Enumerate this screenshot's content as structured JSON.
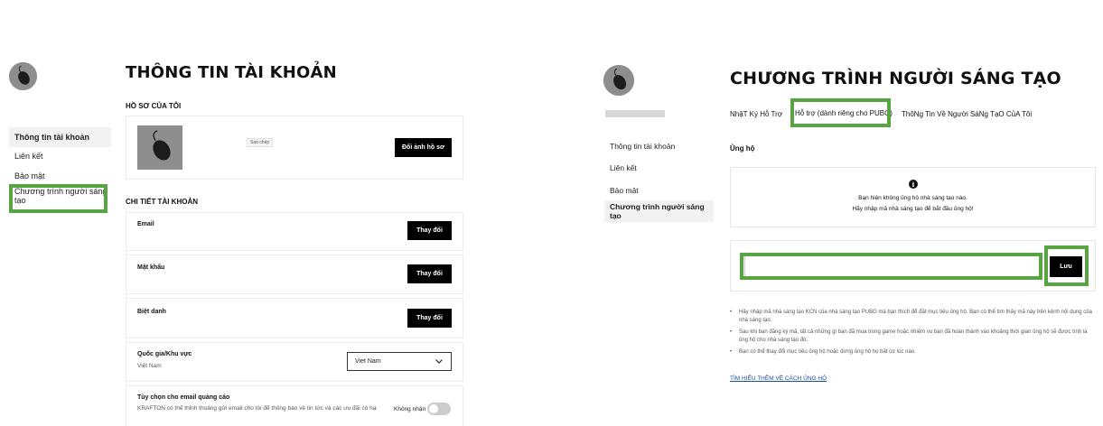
{
  "left": {
    "title": "THÔNG TIN TÀI KHOẢN",
    "nav": [
      {
        "label": "Thông tin tài khoản",
        "active": true
      },
      {
        "label": "Liên kết",
        "active": false
      },
      {
        "label": "Bảo mật",
        "active": false
      },
      {
        "label": "Chương trình người sáng tạo",
        "active": false
      }
    ],
    "profile": {
      "section": "HỒ SƠ CỦA TÔI",
      "copy_badge": "Sao chép",
      "change_avatar": "Đổi ảnh hồ sơ"
    },
    "details": {
      "section": "CHI TIẾT TÀI KHOẢN",
      "email": {
        "label": "Email",
        "button": "Thay đổi"
      },
      "password": {
        "label": "Mật khẩu",
        "button": "Thay đổi"
      },
      "nickname": {
        "label": "Biệt danh",
        "button": "Thay đổi"
      },
      "country": {
        "label": "Quốc gia/Khu vực",
        "value": "Việt Nam",
        "select_value": "Viet Nam"
      },
      "marketing": {
        "label": "Tùy chọn cho email quảng cáo",
        "desc": "KRAFTON có thể thỉnh thoảng gửi email cho tôi để thông báo về tin tức và các ưu đãi có hạn.",
        "toggle_label": "Không nhận"
      }
    }
  },
  "right": {
    "title": "CHƯƠNG TRÌNH NGƯỜI SÁNG TẠO",
    "tabs": [
      {
        "label": "NhậT Ký Hỗ Trợ"
      },
      {
        "label": "Hỗ trợ (dành riêng cho PUBG)"
      },
      {
        "label": "ThôNg Tin Về Người SáNg TạO CủA Tôi"
      }
    ],
    "nav": [
      {
        "label": "Thông tin tài khoản",
        "active": false
      },
      {
        "label": "Liên kết",
        "active": false
      },
      {
        "label": "Bảo mật",
        "active": false
      },
      {
        "label": "Chương trình người sáng tạo",
        "active": true
      }
    ],
    "support_heading": "Ủng hộ",
    "info_icon": "i",
    "empty_line1": "Bạn hiện không ủng hộ nhà sáng tạo nào.",
    "empty_line2": "Hãy nhập mã nhà sáng tạo để bắt đầu ủng hộ!",
    "code_input": {
      "value": "",
      "placeholder": ""
    },
    "save_button": "Lưu",
    "bullets": [
      "Hãy nhập mã nhà sáng tạo KCN của nhà sáng tạo PUBG mà bạn thích để đặt mục tiêu ủng hộ. Bạn có thể tìm thấy mã này trên kênh nội dung của nhà sáng tạo.",
      "Sau khi bạn đăng ký mã, tất cả những gì bạn đã mua trong game hoặc nhiệm vụ bạn đã hoàn thành vào khoảng thời gian ủng hộ sẽ được tính là ủng hộ cho nhà sáng tạo đó.",
      "Bạn có thể thay đổi mục tiêu ủng hộ hoặc dừng ủng hộ họ bất cứ lúc nào."
    ],
    "learn_more": "TÌM HIỂU THÊM VỀ CÁCH ỦNG HỘ"
  },
  "colors": {
    "highlight": "#57a541",
    "button": "#000000"
  },
  "icons": {
    "avatar": "mouse-avatar-icon",
    "info": "info-icon",
    "chevron": "chevron-down-icon"
  }
}
